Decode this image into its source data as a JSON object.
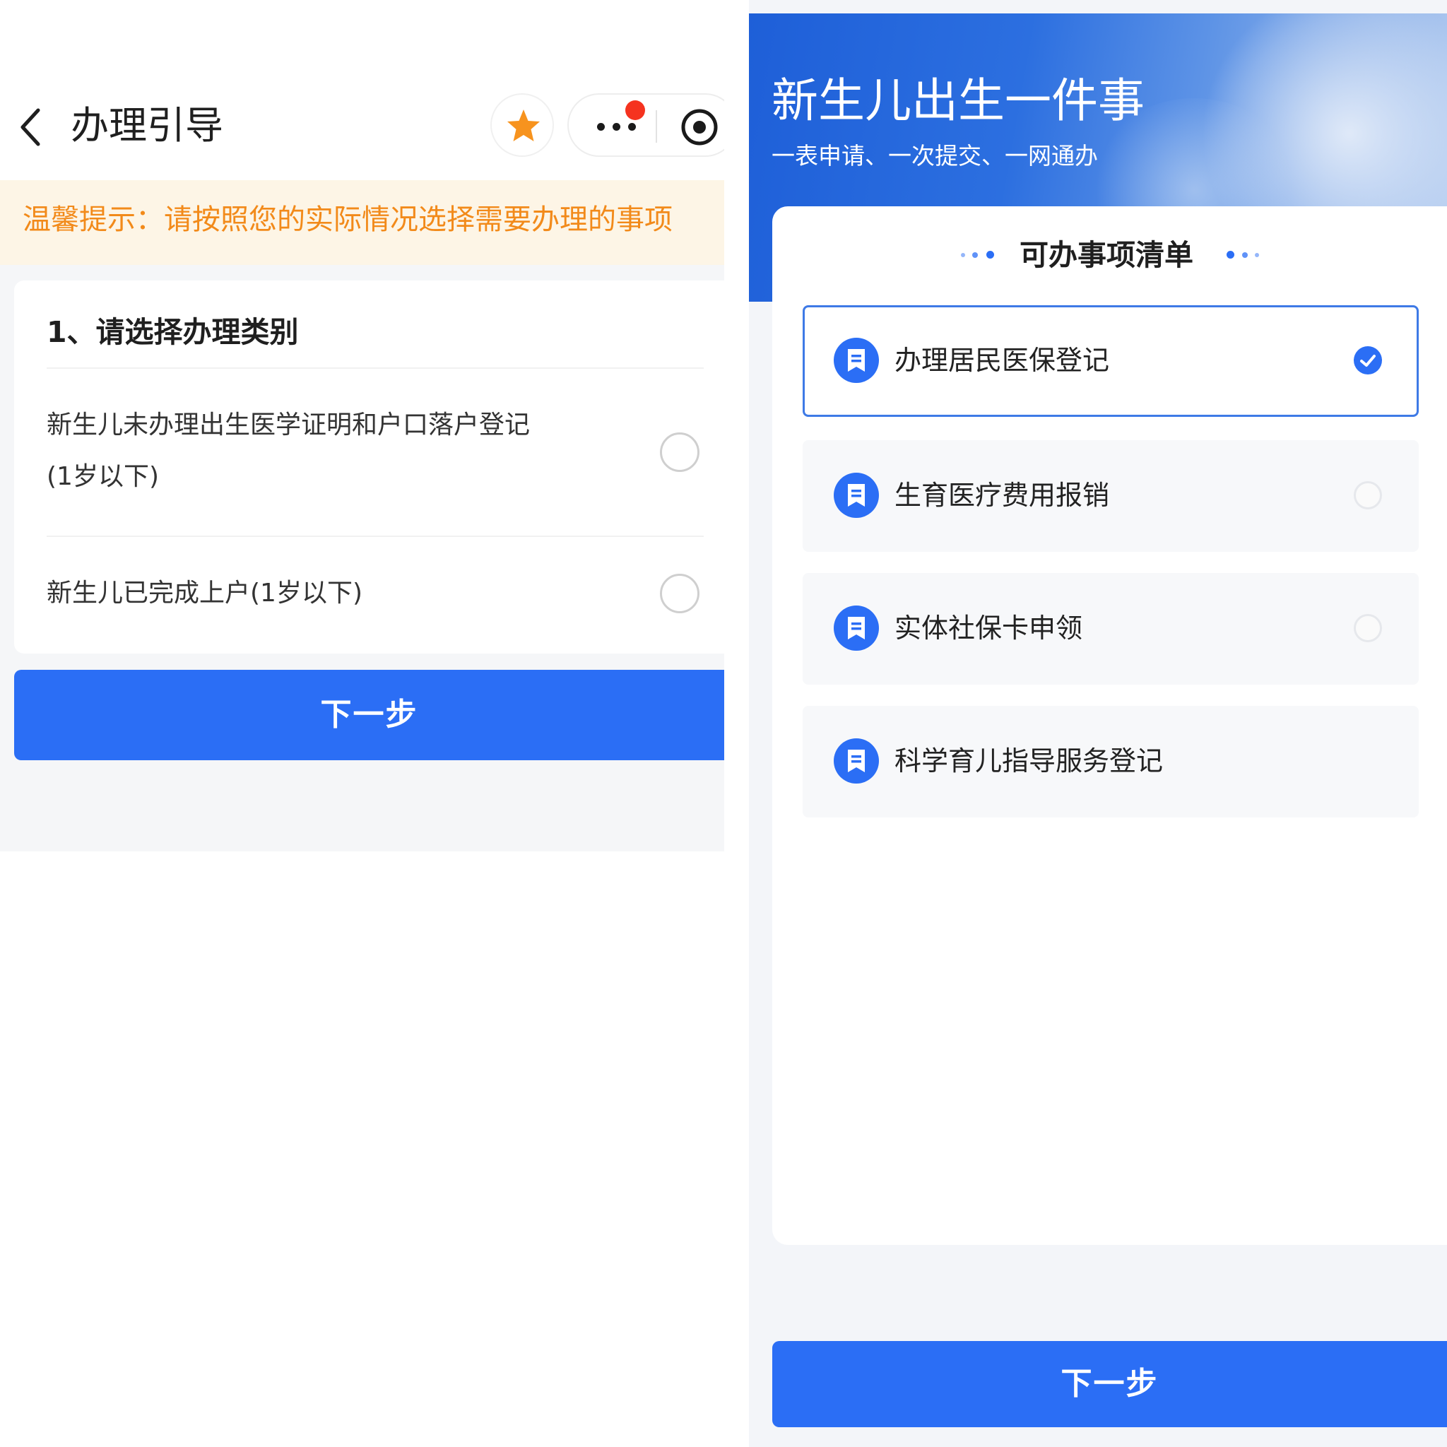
{
  "left": {
    "nav": {
      "title": "办理引导",
      "icons": [
        "back-chevron-icon",
        "star-icon",
        "more-dots-icon",
        "close-circle-icon"
      ],
      "accent": "#f7931e",
      "badge_color": "#f5331f"
    },
    "tip": {
      "text": "温馨提示：请按照您的实际情况选择需要办理的事项",
      "color": "#f28a1a",
      "background": "#fdf5e6"
    },
    "section": {
      "title": "1、请选择办理类别",
      "options": [
        {
          "line1": "新生儿未办理出生医学证明和户口落户登记",
          "line2": "(1岁以下)",
          "selected": false
        },
        {
          "line1": "新生儿已完成上户(1岁以下)",
          "selected": false
        }
      ]
    },
    "next_button": "下一步"
  },
  "right": {
    "banner": {
      "title": "新生儿出生一件事",
      "subtitle": "一表申请、一次提交、一网通办"
    },
    "list": {
      "title": "可办事项清单",
      "items": [
        {
          "label": "办理居民医保登记",
          "selected": true,
          "icon": "document-icon"
        },
        {
          "label": "生育医疗费用报销",
          "selected": false,
          "icon": "document-icon"
        },
        {
          "label": "实体社保卡申领",
          "selected": false,
          "icon": "document-icon"
        },
        {
          "label": "科学育儿指导服务登记",
          "selected": false,
          "icon": "document-icon"
        }
      ]
    },
    "next_button": "下一步",
    "primary_color": "#2b6ef5"
  }
}
